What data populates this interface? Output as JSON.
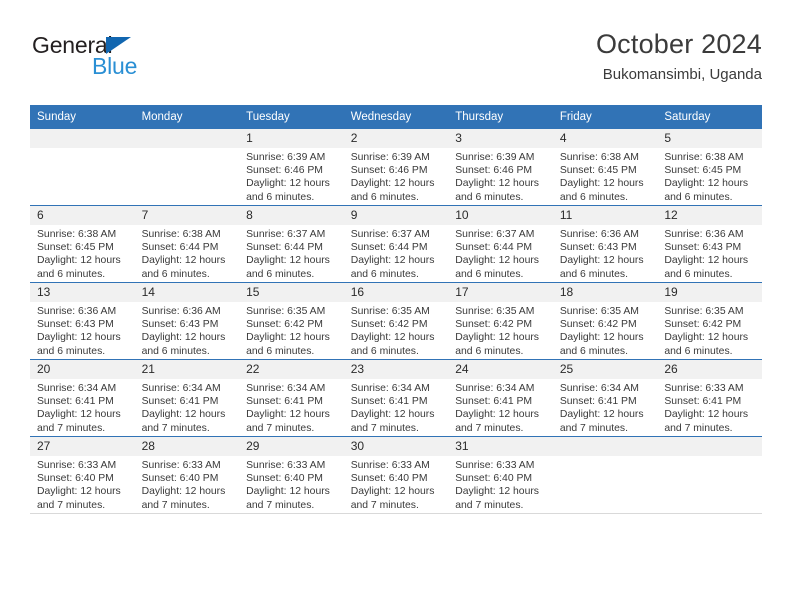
{
  "brand": {
    "word_one": "General",
    "word_two": "Blue",
    "triangle_icon": "triangle-icon",
    "colors": {
      "dark": "#231f20",
      "blue": "#2a8fd4",
      "triangle": "#1166b0"
    }
  },
  "header": {
    "title": "October 2024",
    "subtitle": "Bukomansimbi, Uganda",
    "accent_color": "#3173b6"
  },
  "weekday_headers": [
    "Sunday",
    "Monday",
    "Tuesday",
    "Wednesday",
    "Thursday",
    "Friday",
    "Saturday"
  ],
  "labels": {
    "sunrise_prefix": "Sunrise:",
    "sunset_prefix": "Sunset:",
    "daylight_prefix": "Daylight:"
  },
  "weeks": [
    [
      {
        "empty": true
      },
      {
        "empty": true
      },
      {
        "day": "1",
        "sunrise": "Sunrise: 6:39 AM",
        "sunset": "Sunset: 6:46 PM",
        "daylight_line1": "Daylight: 12 hours",
        "daylight_line2": "and 6 minutes."
      },
      {
        "day": "2",
        "sunrise": "Sunrise: 6:39 AM",
        "sunset": "Sunset: 6:46 PM",
        "daylight_line1": "Daylight: 12 hours",
        "daylight_line2": "and 6 minutes."
      },
      {
        "day": "3",
        "sunrise": "Sunrise: 6:39 AM",
        "sunset": "Sunset: 6:46 PM",
        "daylight_line1": "Daylight: 12 hours",
        "daylight_line2": "and 6 minutes."
      },
      {
        "day": "4",
        "sunrise": "Sunrise: 6:38 AM",
        "sunset": "Sunset: 6:45 PM",
        "daylight_line1": "Daylight: 12 hours",
        "daylight_line2": "and 6 minutes."
      },
      {
        "day": "5",
        "sunrise": "Sunrise: 6:38 AM",
        "sunset": "Sunset: 6:45 PM",
        "daylight_line1": "Daylight: 12 hours",
        "daylight_line2": "and 6 minutes."
      }
    ],
    [
      {
        "day": "6",
        "sunrise": "Sunrise: 6:38 AM",
        "sunset": "Sunset: 6:45 PM",
        "daylight_line1": "Daylight: 12 hours",
        "daylight_line2": "and 6 minutes."
      },
      {
        "day": "7",
        "sunrise": "Sunrise: 6:38 AM",
        "sunset": "Sunset: 6:44 PM",
        "daylight_line1": "Daylight: 12 hours",
        "daylight_line2": "and 6 minutes."
      },
      {
        "day": "8",
        "sunrise": "Sunrise: 6:37 AM",
        "sunset": "Sunset: 6:44 PM",
        "daylight_line1": "Daylight: 12 hours",
        "daylight_line2": "and 6 minutes."
      },
      {
        "day": "9",
        "sunrise": "Sunrise: 6:37 AM",
        "sunset": "Sunset: 6:44 PM",
        "daylight_line1": "Daylight: 12 hours",
        "daylight_line2": "and 6 minutes."
      },
      {
        "day": "10",
        "sunrise": "Sunrise: 6:37 AM",
        "sunset": "Sunset: 6:44 PM",
        "daylight_line1": "Daylight: 12 hours",
        "daylight_line2": "and 6 minutes."
      },
      {
        "day": "11",
        "sunrise": "Sunrise: 6:36 AM",
        "sunset": "Sunset: 6:43 PM",
        "daylight_line1": "Daylight: 12 hours",
        "daylight_line2": "and 6 minutes."
      },
      {
        "day": "12",
        "sunrise": "Sunrise: 6:36 AM",
        "sunset": "Sunset: 6:43 PM",
        "daylight_line1": "Daylight: 12 hours",
        "daylight_line2": "and 6 minutes."
      }
    ],
    [
      {
        "day": "13",
        "sunrise": "Sunrise: 6:36 AM",
        "sunset": "Sunset: 6:43 PM",
        "daylight_line1": "Daylight: 12 hours",
        "daylight_line2": "and 6 minutes."
      },
      {
        "day": "14",
        "sunrise": "Sunrise: 6:36 AM",
        "sunset": "Sunset: 6:43 PM",
        "daylight_line1": "Daylight: 12 hours",
        "daylight_line2": "and 6 minutes."
      },
      {
        "day": "15",
        "sunrise": "Sunrise: 6:35 AM",
        "sunset": "Sunset: 6:42 PM",
        "daylight_line1": "Daylight: 12 hours",
        "daylight_line2": "and 6 minutes."
      },
      {
        "day": "16",
        "sunrise": "Sunrise: 6:35 AM",
        "sunset": "Sunset: 6:42 PM",
        "daylight_line1": "Daylight: 12 hours",
        "daylight_line2": "and 6 minutes."
      },
      {
        "day": "17",
        "sunrise": "Sunrise: 6:35 AM",
        "sunset": "Sunset: 6:42 PM",
        "daylight_line1": "Daylight: 12 hours",
        "daylight_line2": "and 6 minutes."
      },
      {
        "day": "18",
        "sunrise": "Sunrise: 6:35 AM",
        "sunset": "Sunset: 6:42 PM",
        "daylight_line1": "Daylight: 12 hours",
        "daylight_line2": "and 6 minutes."
      },
      {
        "day": "19",
        "sunrise": "Sunrise: 6:35 AM",
        "sunset": "Sunset: 6:42 PM",
        "daylight_line1": "Daylight: 12 hours",
        "daylight_line2": "and 6 minutes."
      }
    ],
    [
      {
        "day": "20",
        "sunrise": "Sunrise: 6:34 AM",
        "sunset": "Sunset: 6:41 PM",
        "daylight_line1": "Daylight: 12 hours",
        "daylight_line2": "and 7 minutes."
      },
      {
        "day": "21",
        "sunrise": "Sunrise: 6:34 AM",
        "sunset": "Sunset: 6:41 PM",
        "daylight_line1": "Daylight: 12 hours",
        "daylight_line2": "and 7 minutes."
      },
      {
        "day": "22",
        "sunrise": "Sunrise: 6:34 AM",
        "sunset": "Sunset: 6:41 PM",
        "daylight_line1": "Daylight: 12 hours",
        "daylight_line2": "and 7 minutes."
      },
      {
        "day": "23",
        "sunrise": "Sunrise: 6:34 AM",
        "sunset": "Sunset: 6:41 PM",
        "daylight_line1": "Daylight: 12 hours",
        "daylight_line2": "and 7 minutes."
      },
      {
        "day": "24",
        "sunrise": "Sunrise: 6:34 AM",
        "sunset": "Sunset: 6:41 PM",
        "daylight_line1": "Daylight: 12 hours",
        "daylight_line2": "and 7 minutes."
      },
      {
        "day": "25",
        "sunrise": "Sunrise: 6:34 AM",
        "sunset": "Sunset: 6:41 PM",
        "daylight_line1": "Daylight: 12 hours",
        "daylight_line2": "and 7 minutes."
      },
      {
        "day": "26",
        "sunrise": "Sunrise: 6:33 AM",
        "sunset": "Sunset: 6:41 PM",
        "daylight_line1": "Daylight: 12 hours",
        "daylight_line2": "and 7 minutes."
      }
    ],
    [
      {
        "day": "27",
        "sunrise": "Sunrise: 6:33 AM",
        "sunset": "Sunset: 6:40 PM",
        "daylight_line1": "Daylight: 12 hours",
        "daylight_line2": "and 7 minutes."
      },
      {
        "day": "28",
        "sunrise": "Sunrise: 6:33 AM",
        "sunset": "Sunset: 6:40 PM",
        "daylight_line1": "Daylight: 12 hours",
        "daylight_line2": "and 7 minutes."
      },
      {
        "day": "29",
        "sunrise": "Sunrise: 6:33 AM",
        "sunset": "Sunset: 6:40 PM",
        "daylight_line1": "Daylight: 12 hours",
        "daylight_line2": "and 7 minutes."
      },
      {
        "day": "30",
        "sunrise": "Sunrise: 6:33 AM",
        "sunset": "Sunset: 6:40 PM",
        "daylight_line1": "Daylight: 12 hours",
        "daylight_line2": "and 7 minutes."
      },
      {
        "day": "31",
        "sunrise": "Sunrise: 6:33 AM",
        "sunset": "Sunset: 6:40 PM",
        "daylight_line1": "Daylight: 12 hours",
        "daylight_line2": "and 7 minutes."
      },
      {
        "empty": true
      },
      {
        "empty": true
      }
    ]
  ]
}
